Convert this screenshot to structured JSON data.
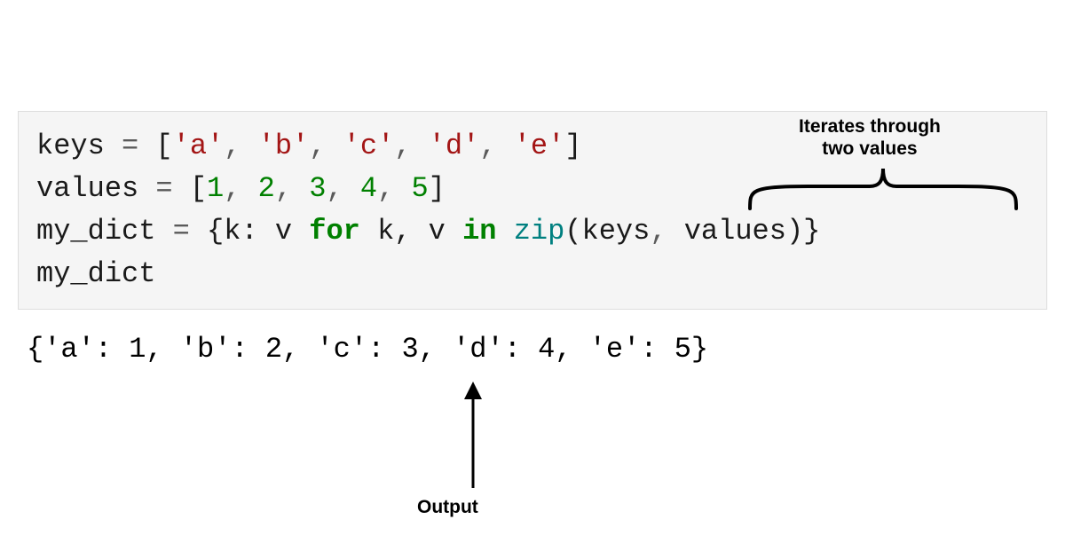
{
  "code": {
    "line1": {
      "var": "keys",
      "eq": " = ",
      "open": "[",
      "s1": "'a'",
      "c1": ", ",
      "s2": "'b'",
      "c2": ", ",
      "s3": "'c'",
      "c3": ", ",
      "s4": "'d'",
      "c4": ", ",
      "s5": "'e'",
      "close": "]"
    },
    "line2": {
      "var": "values",
      "eq": " = ",
      "open": "[",
      "n1": "1",
      "c1": ", ",
      "n2": "2",
      "c2": ", ",
      "n3": "3",
      "c3": ", ",
      "n4": "4",
      "c4": ", ",
      "n5": "5",
      "close": "]"
    },
    "line3": {
      "var": "my_dict",
      "eq": " = ",
      "open": "{",
      "k": "k",
      "colon": ": ",
      "v": "v ",
      "for": "for",
      "loop": " k, v ",
      "in": "in",
      "sp": " ",
      "zip": "zip",
      "paren_open": "(",
      "arg1": "keys",
      "comma": ", ",
      "arg2": "values",
      "paren_close": ")",
      "close": "}"
    },
    "line4": {
      "var": "my_dict"
    }
  },
  "output": "{'a': 1, 'b': 2, 'c': 3, 'd': 4, 'e': 5}",
  "annotations": {
    "top": "Iterates through\ntwo values",
    "bottom": "Output"
  }
}
